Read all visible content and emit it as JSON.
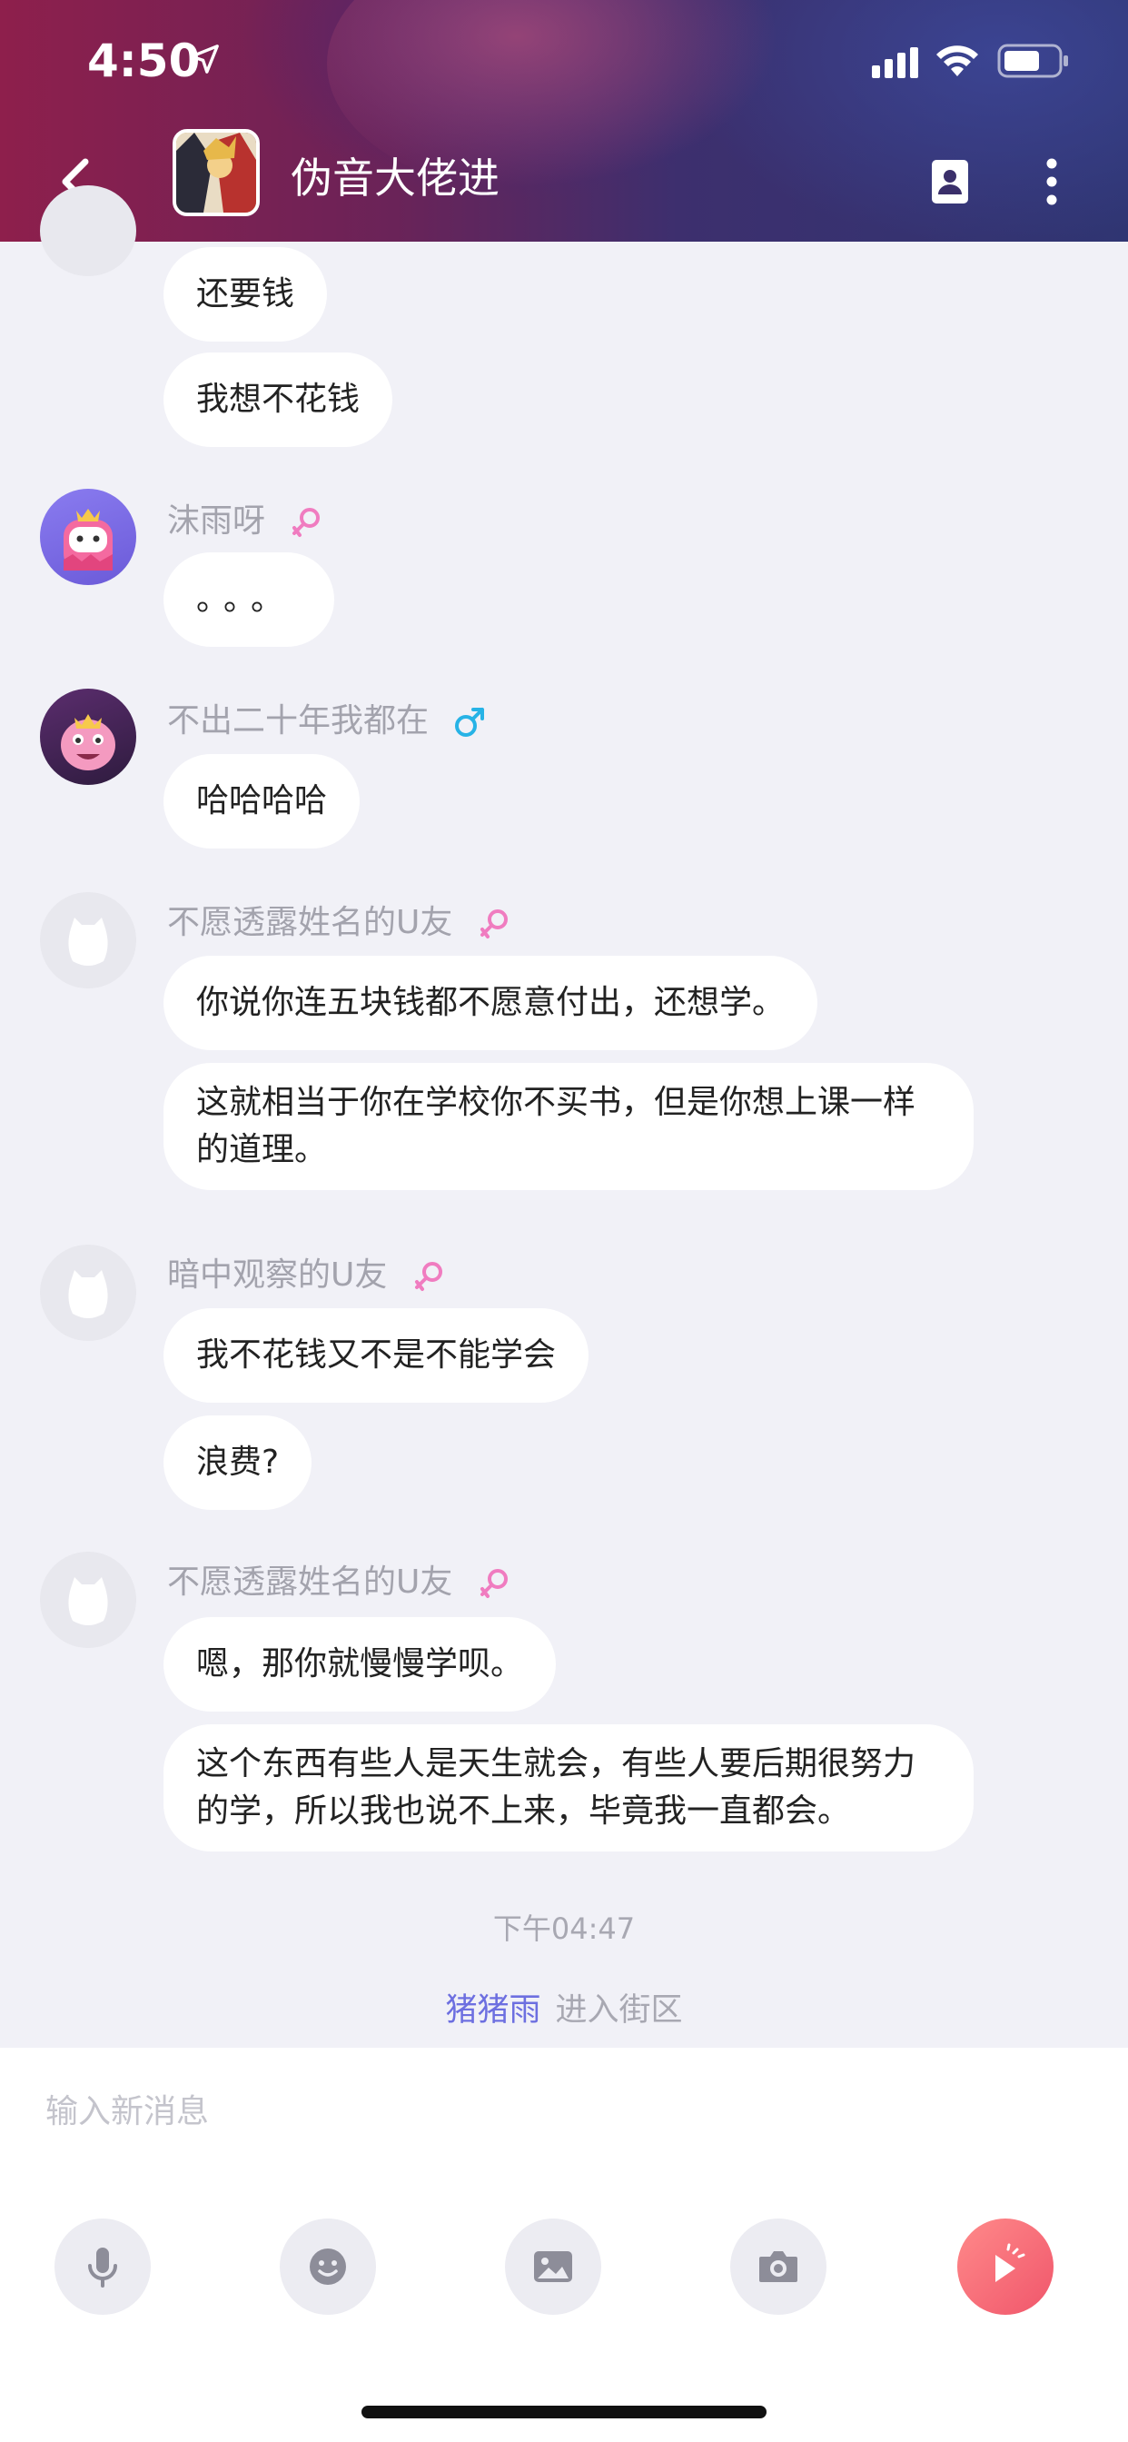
{
  "status_bar": {
    "time": "4:50"
  },
  "header": {
    "title": "伪音大佬进"
  },
  "messages": [
    {
      "text": "还要钱"
    },
    {
      "text": "我想不花钱"
    },
    {
      "sender": "沫雨呀",
      "gender": "female",
      "text": "。。。"
    },
    {
      "sender": "不出二十年我都在",
      "gender": "male",
      "text": "哈哈哈哈"
    },
    {
      "sender": "不愿透露姓名的U友",
      "gender": "female",
      "texts": [
        "你说你连五块钱都不愿意付出，还想学。",
        "这就相当于你在学校你不买书，但是你想上课一样的道理。"
      ]
    },
    {
      "sender": "暗中观察的U友",
      "gender": "female",
      "texts": [
        "我不花钱又不是不能学会",
        "浪费?"
      ]
    },
    {
      "sender": "不愿透露姓名的U友",
      "gender": "female",
      "texts": [
        "嗯，那你就慢慢学呗。",
        "这个东西有些人是天生就会，有些人要后期很努力的学，所以我也说不上来，毕竟我一直都会。"
      ]
    }
  ],
  "timestamp": "下午04:47",
  "system_notice": {
    "user": "猪猪雨",
    "action": "进入街区"
  },
  "input": {
    "placeholder": "输入新消息",
    "value": ""
  },
  "toolbar": [
    "microphone-icon",
    "emoji-icon",
    "image-icon",
    "camera-icon",
    "send-icon"
  ],
  "colors": {
    "female": "#f07cc0",
    "male": "#27b3e6",
    "accent": "#6d6fe0",
    "send": "#f0566b"
  }
}
